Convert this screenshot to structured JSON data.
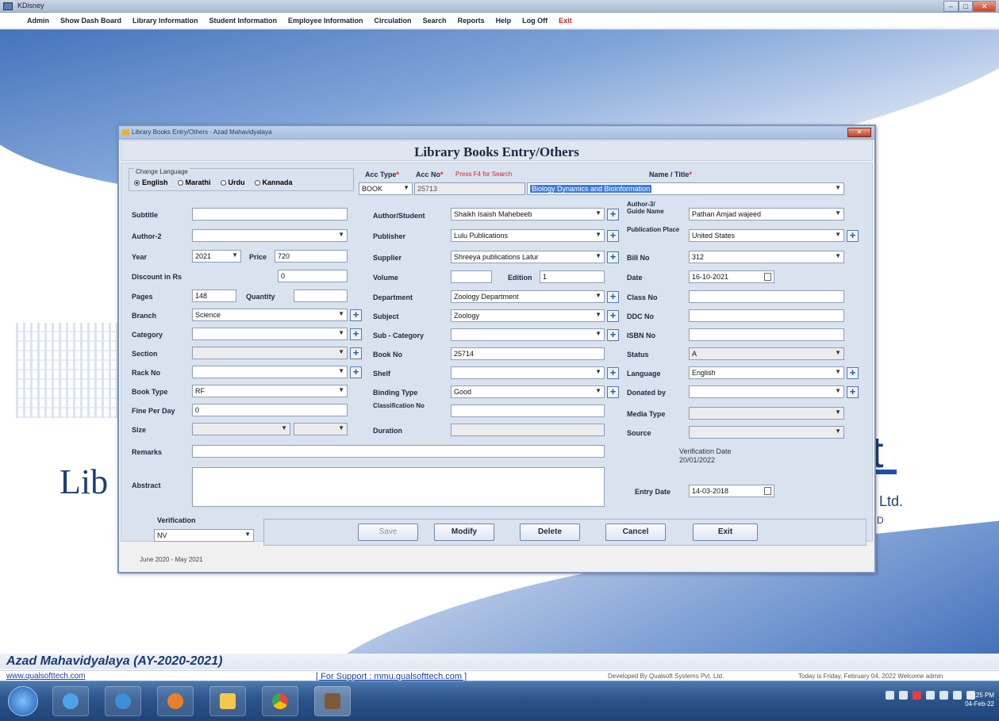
{
  "window": {
    "title": "KDisney",
    "min": "–",
    "max": "□",
    "close": "✕"
  },
  "menu": [
    "Admin",
    "Show Dash Board",
    "Library Information",
    "Student Information",
    "Employee Information",
    "Circulation",
    "Search",
    "Reports",
    "Help",
    "Log Off",
    "Exit"
  ],
  "background": {
    "logo_text": "Lib",
    "right_big": "t",
    "right_line1": ". Ltd.",
    "right_line2": "D"
  },
  "dialog": {
    "title": "Library Books Entry/Others - Azad Mahavidyalaya",
    "close": "✕",
    "heading": "Library Books Entry/Others",
    "language": {
      "caption": "Change Language",
      "options": [
        "English",
        "Marathi",
        "Urdu",
        "Kannada"
      ],
      "selected": "English"
    },
    "acc_type_label": "Acc Type",
    "acc_type_value": "BOOK",
    "acc_no_label": "Acc No",
    "acc_no_hint": "Press F4 for Search",
    "acc_no_value": "25713",
    "name_title_label": "Name / Title",
    "name_title_value": "Biology Dynamics and Bioinformation",
    "fields": {
      "subtitle": {
        "label": "Subtitle",
        "value": ""
      },
      "author2": {
        "label": "Author-2",
        "value": ""
      },
      "year": {
        "label": "Year",
        "value": "2021"
      },
      "price": {
        "label": "Price",
        "value": "720"
      },
      "discount": {
        "label": "Discount in Rs",
        "value": "0"
      },
      "pages": {
        "label": "Pages",
        "value": "148"
      },
      "quantity": {
        "label": "Quantity",
        "value": ""
      },
      "branch": {
        "label": "Branch",
        "value": "Science"
      },
      "category": {
        "label": "Category",
        "value": ""
      },
      "section": {
        "label": "Section",
        "value": ""
      },
      "rack": {
        "label": "Rack No",
        "value": ""
      },
      "book_type": {
        "label": "Book Type",
        "value": "RF"
      },
      "fine_per_day": {
        "label": "Fine Per Day",
        "value": "0"
      },
      "size": {
        "label": "Size",
        "value": ""
      },
      "remarks": {
        "label": "Remarks",
        "value": ""
      },
      "abstract": {
        "label": "Abstract",
        "value": ""
      },
      "author_student": {
        "label": "Author/Student",
        "value": "Shaikh Isaish Mahebeeb"
      },
      "publisher": {
        "label": "Publisher",
        "value": "Lulu Publications"
      },
      "supplier": {
        "label": "Supplier",
        "value": "Shreeya publications Latur"
      },
      "volume": {
        "label": "Volume",
        "value": ""
      },
      "edition": {
        "label": "Edition",
        "value": "1"
      },
      "department": {
        "label": "Department",
        "value": "Zoology Department"
      },
      "subject": {
        "label": "Subject",
        "value": "Zoology"
      },
      "sub_category": {
        "label": "Sub - Category",
        "value": ""
      },
      "book_no": {
        "label": "Book No",
        "value": "25714"
      },
      "shelf": {
        "label": "Shelf",
        "value": ""
      },
      "binding_type": {
        "label": "Binding Type",
        "value": "Good"
      },
      "classification": {
        "label": "Classification No",
        "value": ""
      },
      "duration": {
        "label": "Duration",
        "value": ""
      },
      "author3": {
        "label": "Author-3/ Guide Name",
        "value": "Pathan Amjad wajeed"
      },
      "publication_place": {
        "label": "Publication Place",
        "value": "United States"
      },
      "bill_no": {
        "label": "Bill No",
        "value": "312"
      },
      "date": {
        "label": "Date",
        "value": "16-10-2021"
      },
      "class_no": {
        "label": "Class No",
        "value": ""
      },
      "ddc_no": {
        "label": "DDC No",
        "value": ""
      },
      "isbn_no": {
        "label": "ISBN No",
        "value": ""
      },
      "status": {
        "label": "Status",
        "value": "A"
      },
      "language": {
        "label": "Language",
        "value": "English"
      },
      "donated_by": {
        "label": "Donated by",
        "value": ""
      },
      "media_type": {
        "label": "Media Type",
        "value": ""
      },
      "source": {
        "label": "Source",
        "value": ""
      },
      "verification_date": {
        "label": "Verification Date",
        "value": "20/01/2022"
      },
      "entry_date": {
        "label": "Entry Date",
        "value": "14-03-2018"
      }
    },
    "verification": {
      "label": "Verification",
      "value": "NV"
    },
    "buttons": {
      "save": "Save",
      "modify": "Modify",
      "delete": "Delete",
      "cancel": "Cancel",
      "exit": "Exit"
    },
    "footer": "June 2020 - May 2021"
  },
  "status": {
    "college": "Azad Mahavidyalaya (AY-2020-2021)",
    "website": "www.qualsofttech.com",
    "support": "[ For Support : mmu.qualsofttech.com ]",
    "developed": "Developed By Qualsoft Systems Pvt. Ltd.",
    "today": "Today is Friday, February 04, 2022   Welcome admin"
  },
  "taskbar": {
    "time": "12:25 PM",
    "date": "04-Feb-22"
  }
}
